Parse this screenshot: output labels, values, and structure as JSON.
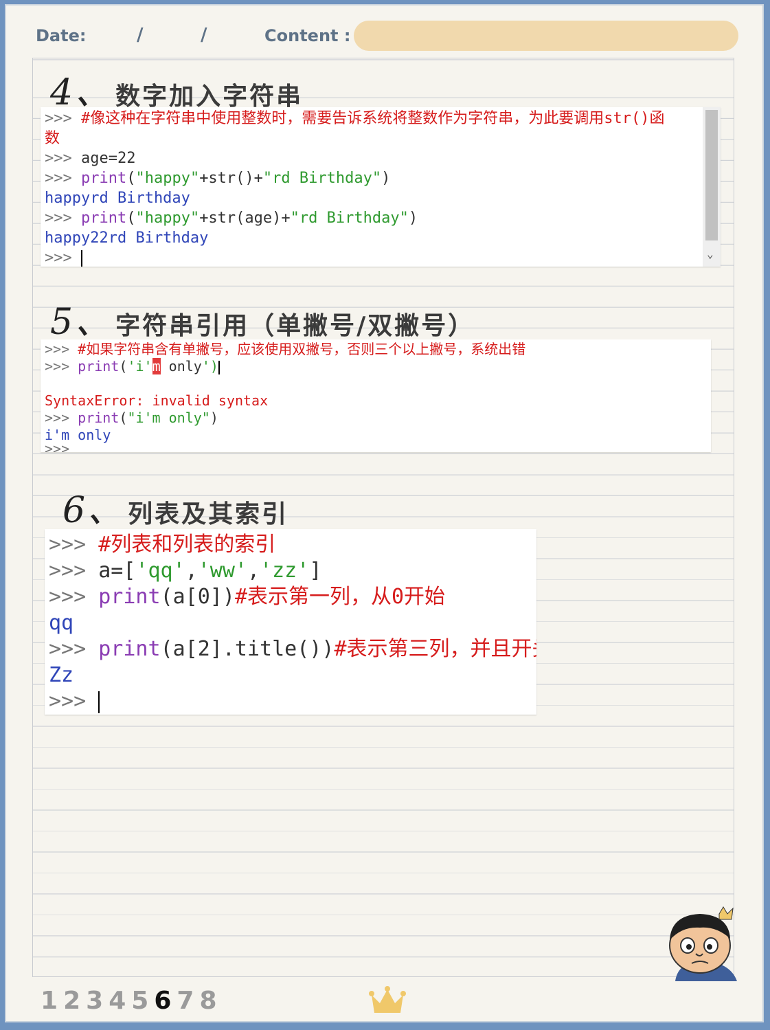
{
  "header": {
    "date_label": "Date:",
    "date_sep1": "/",
    "date_sep2": "/",
    "content_label": "Content :"
  },
  "section4": {
    "num": "4、",
    "title": "数字加入字符串",
    "code": {
      "l1_prompt": ">>> ",
      "l1_comment": "#像这种在字符串中使用整数时，需要告诉系统将整数作为字符串，为此要调用str()函",
      "l1b_comment": "数",
      "l2_prompt": ">>> ",
      "l2_code": "age=22",
      "l3_prompt": ">>> ",
      "l3_kw": "print",
      "l3_a": "(",
      "l3_s1": "\"happy\"",
      "l3_b": "+str()+",
      "l3_s2": "\"rd Birthday\"",
      "l3_c": ")",
      "l4_out": "happyrd Birthday",
      "l5_prompt": ">>> ",
      "l5_kw": "print",
      "l5_a": "(",
      "l5_s1": "\"happy\"",
      "l5_b": "+str(age)+",
      "l5_s2": "\"rd Birthday\"",
      "l5_c": ")",
      "l6_out": "happy22rd Birthday",
      "l7_prompt": ">>> "
    }
  },
  "section5": {
    "num": "5、",
    "title": "字符串引用（单撇号/双撇号）",
    "code": {
      "l1_prompt": ">>> ",
      "l1_comment": "#如果字符串含有单撇号，应该使用双撇号，否则三个以上撇号，系统出错",
      "l2_prompt": ">>> ",
      "l2_kw": "print",
      "l2_a": "(",
      "l2_s1": "'i'",
      "l2_err": "m",
      "l2_b": " only",
      "l2_s2": "')",
      "l3_err": "SyntaxError: invalid syntax",
      "l4_prompt": ">>> ",
      "l4_kw": "print",
      "l4_a": "(",
      "l4_s": "\"i'm only\"",
      "l4_c": ")",
      "l5_out": "i'm only",
      "l6_prompt": ">>>"
    }
  },
  "section6": {
    "num": "6、",
    "title": "列表及其索引",
    "code": {
      "l1_prompt": ">>> ",
      "l1_comment": "#列表和列表的索引",
      "l2_prompt": ">>> ",
      "l2_a": "a=[",
      "l2_s1": "'qq'",
      "l2_c1": ",",
      "l2_s2": "'ww'",
      "l2_c2": ",",
      "l2_s3": "'zz'",
      "l2_b": "]",
      "l3_prompt": ">>> ",
      "l3_kw": "print",
      "l3_code": "(a[0])",
      "l3_comment": "#表示第一列，从0开始",
      "l4_out": "qq",
      "l5_prompt": ">>> ",
      "l5_kw": "print",
      "l5_code": "(a[2].title())",
      "l5_comment": "#表示第三列，并且开头大写",
      "l6_out": "Zz",
      "l7_prompt": ">>> "
    }
  },
  "pagination": {
    "p1": "1",
    "p2": "2",
    "p3": "3",
    "p4": "4",
    "p5": "5",
    "p6": "6",
    "p7": "7",
    "p8": "8",
    "active": "6"
  },
  "colors": {
    "frame": "#6f93bf",
    "paper": "#f6f4ee",
    "content_field": "#f1d9ad",
    "keyword": "#8a3cb3",
    "string": "#2f9a2f",
    "comment": "#d61c1c",
    "output": "#2f45b8"
  },
  "icons": {
    "crown": "crown-icon",
    "avatar": "cartoon-prince-avatar"
  }
}
